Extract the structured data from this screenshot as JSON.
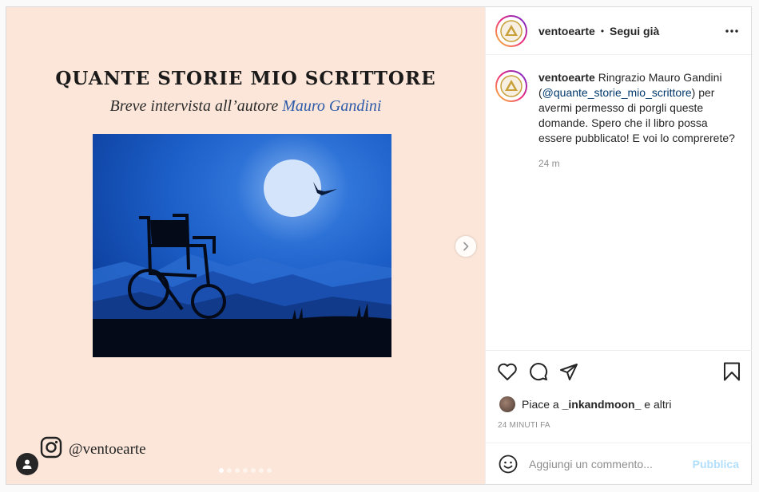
{
  "media": {
    "title": "QUANTE STORIE MIO SCRITTORE",
    "subtitle_prefix": "Breve intervista all’autore ",
    "subtitle_author": "Mauro Gandini",
    "watermark_handle": "@ventoearte",
    "carousel_dots": 7,
    "carousel_active": 0
  },
  "header": {
    "username": "ventoearte",
    "separator": "•",
    "follow_label": "Segui già"
  },
  "caption": {
    "username": "ventoearte",
    "text_before": " Ringrazio Mauro Gandini (",
    "mention": "@quante_storie_mio_scrittore",
    "text_after": ") per avermi permesso di porgli queste domande. Spero che il libro possa essere pubblicato! E voi lo comprerete?",
    "time": "24 m"
  },
  "likes": {
    "prefix": "Piace a ",
    "user": "_inkandmoon_",
    "suffix": " e altri"
  },
  "timestamp": "24 MINUTI FA",
  "comment": {
    "placeholder": "Aggiungi un commento...",
    "publish_label": "Pubblica"
  },
  "colors": {
    "media_bg": "#fbe6d9",
    "mention": "#00376b",
    "publish_disabled": "#b2dffc",
    "author_blue": "#2d5aa8"
  }
}
